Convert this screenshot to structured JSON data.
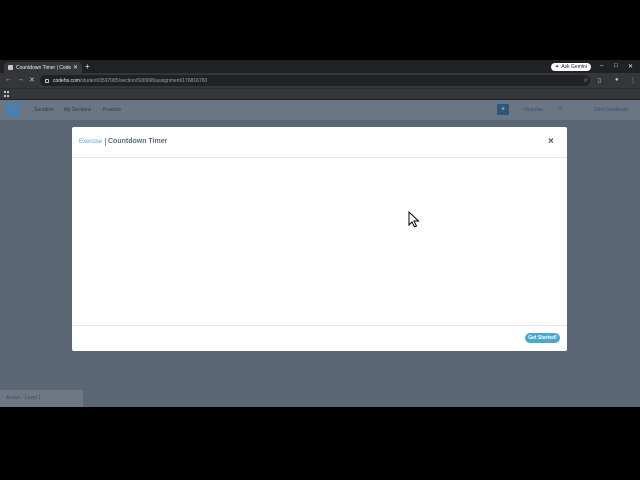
{
  "browser": {
    "tab_title": "Countdown Timer | CodeHS",
    "new_tab": "+",
    "ask_gemini": "Ask Gemini",
    "url_host": "codehs.com",
    "url_path": "/student/3597085/section/500998/assignment/176816760"
  },
  "site_nav": {
    "links": [
      "Sandbox",
      "My Sections",
      "Practice"
    ],
    "plus": "+",
    "resume": "Resume",
    "username": "John Goodman"
  },
  "modal": {
    "kicker": "Exercise",
    "title": "Countdown Timer",
    "close": "×",
    "start_button": "Get Started!"
  },
  "bottom_tag": "Arrays - Level 1",
  "colors": {
    "accent": "#4aa8cf",
    "overlay": "#5b6675",
    "browser_chrome": "#35363a"
  }
}
